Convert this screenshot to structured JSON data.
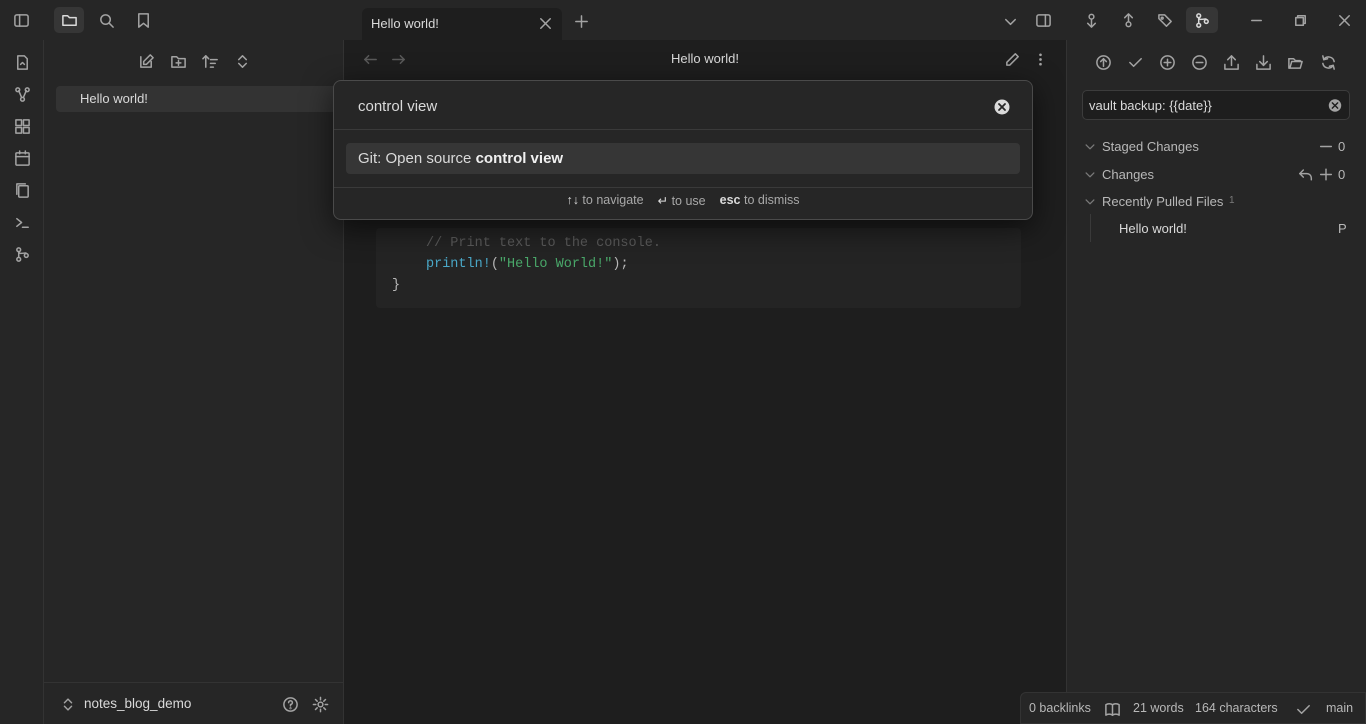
{
  "tab": {
    "title": "Hello world!"
  },
  "editor": {
    "header_title": "Hello world!",
    "code": {
      "comment": "// Print text to the console.",
      "fn": "println!",
      "open": "(",
      "str": "\"Hello World!\"",
      "close": ");",
      "brace": "}"
    }
  },
  "file_explorer": {
    "files": [
      {
        "label": "Hello world!"
      }
    ]
  },
  "vault": {
    "name": "notes_blog_demo"
  },
  "palette": {
    "query": "control view",
    "result_prefix": "Git: Open source ",
    "result_match": "control view",
    "hints": [
      {
        "key": "↑↓",
        "text": "to navigate"
      },
      {
        "key": "↵",
        "text": "to use"
      },
      {
        "key": "esc",
        "text": "to dismiss"
      }
    ]
  },
  "git": {
    "commit_message": "vault backup: {{date}}",
    "staged_label": "Staged Changes",
    "staged_count": "0",
    "changes_label": "Changes",
    "changes_count": "0",
    "pulled_label": "Recently Pulled Files",
    "pulled_count": "1",
    "pulled_files": [
      {
        "name": "Hello world!",
        "status": "P"
      }
    ]
  },
  "status_bar": {
    "backlinks": "0 backlinks",
    "words": "21 words",
    "characters": "164 characters",
    "branch": "main"
  }
}
